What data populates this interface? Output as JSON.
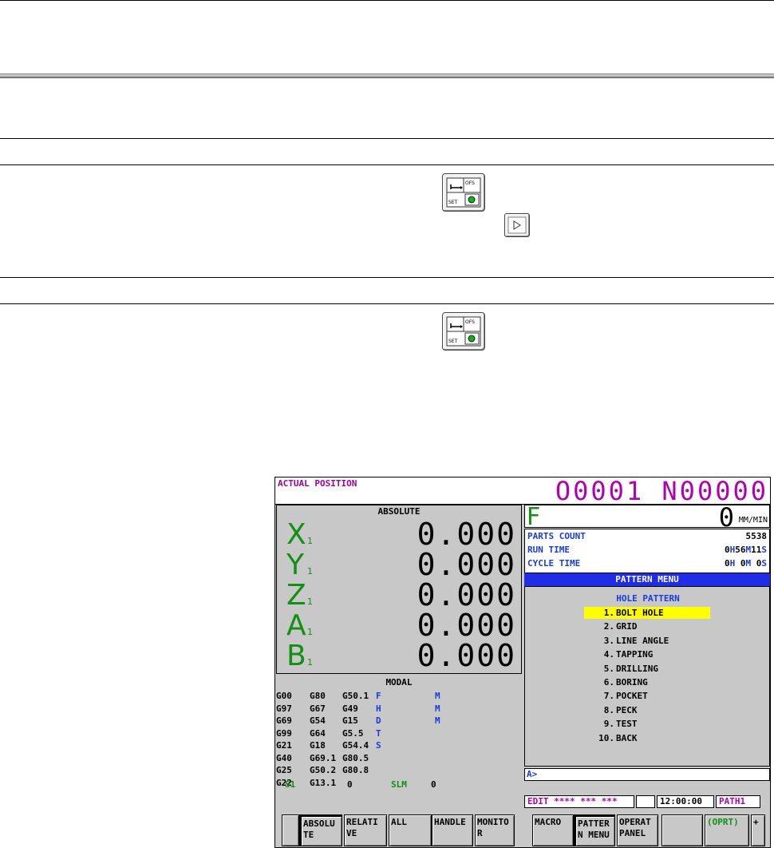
{
  "screen": {
    "title": "ACTUAL POSITION",
    "program": "O0001 N00000",
    "absolute_title": "ABSOLUTE",
    "axes": [
      {
        "letter": "X",
        "sub": "1",
        "value": "0.000"
      },
      {
        "letter": "Y",
        "sub": "1",
        "value": "0.000"
      },
      {
        "letter": "Z",
        "sub": "1",
        "value": "0.000"
      },
      {
        "letter": "A",
        "sub": "1",
        "value": "0.000"
      },
      {
        "letter": "B",
        "sub": "1",
        "value": "0.000"
      }
    ],
    "modal": {
      "title": "MODAL",
      "rows": [
        [
          "G00",
          "G80",
          "G50.1",
          "F",
          "M"
        ],
        [
          "G97",
          "G67",
          "G49",
          "H",
          "M"
        ],
        [
          "G69",
          "G54",
          "G15",
          "D",
          "M"
        ],
        [
          "G99",
          "G64",
          "G5.5",
          "T",
          ""
        ],
        [
          "G21",
          "G18",
          "G54.4",
          "S",
          ""
        ],
        [
          "G40",
          "G69.1",
          "G80.5",
          "",
          ""
        ],
        [
          "G25",
          "G50.2",
          "G80.8",
          "",
          ""
        ],
        [
          "G22",
          "G13.1",
          "",
          "",
          ""
        ]
      ],
      "spindle_label": "S1",
      "spindle_value": "0",
      "slm_label": "SLM",
      "slm_value": "0"
    },
    "feed": {
      "letter": "F",
      "value": "0",
      "unit": "MM/MIN"
    },
    "counts": {
      "parts_label": "PARTS COUNT",
      "parts_value": "5538",
      "run_label": "RUN TIME",
      "run_h": "0",
      "run_m": "56",
      "run_s": "11",
      "cycle_label": "CYCLE TIME",
      "cycle_h": "0",
      "cycle_m": "0",
      "cycle_s": "0",
      "h": "H",
      "m": "M",
      "s": "S"
    },
    "pattern_menu": {
      "header": "PATTERN MENU",
      "subtitle": "HOLE PATTERN",
      "items": [
        {
          "num": "1.",
          "label": "BOLT HOLE"
        },
        {
          "num": "2.",
          "label": "GRID"
        },
        {
          "num": "3.",
          "label": "LINE ANGLE"
        },
        {
          "num": "4.",
          "label": "TAPPING"
        },
        {
          "num": "5.",
          "label": "DRILLING"
        },
        {
          "num": "6.",
          "label": "BORING"
        },
        {
          "num": "7.",
          "label": "POCKET"
        },
        {
          "num": "8.",
          "label": "PECK"
        },
        {
          "num": "9.",
          "label": "TEST"
        },
        {
          "num": "10.",
          "label": "BACK"
        }
      ]
    },
    "input_prompt": "A>",
    "status": {
      "mode": "EDIT **** *** ***",
      "time": "12:00:00",
      "path": "PATH1"
    },
    "softkeys": [
      "",
      "ABSOLU\nTE",
      "RELATI\nVE",
      "ALL",
      "HANDLE",
      "MONITO\nR",
      "",
      "MACRO",
      "PATTER\nN MENU",
      "OPERAT\nPANEL",
      "",
      "(OPRT)",
      "+"
    ]
  },
  "colors": {
    "axis_green": "#139013",
    "program_magenta": "#b000b0",
    "label_blue": "#1a3ae0",
    "header_blue": "#1f2ee6",
    "highlight_yellow": "#ffff00"
  },
  "keys": {
    "offset_key_label": "OFS SET",
    "next_key_icon": "triangle-right-icon"
  }
}
